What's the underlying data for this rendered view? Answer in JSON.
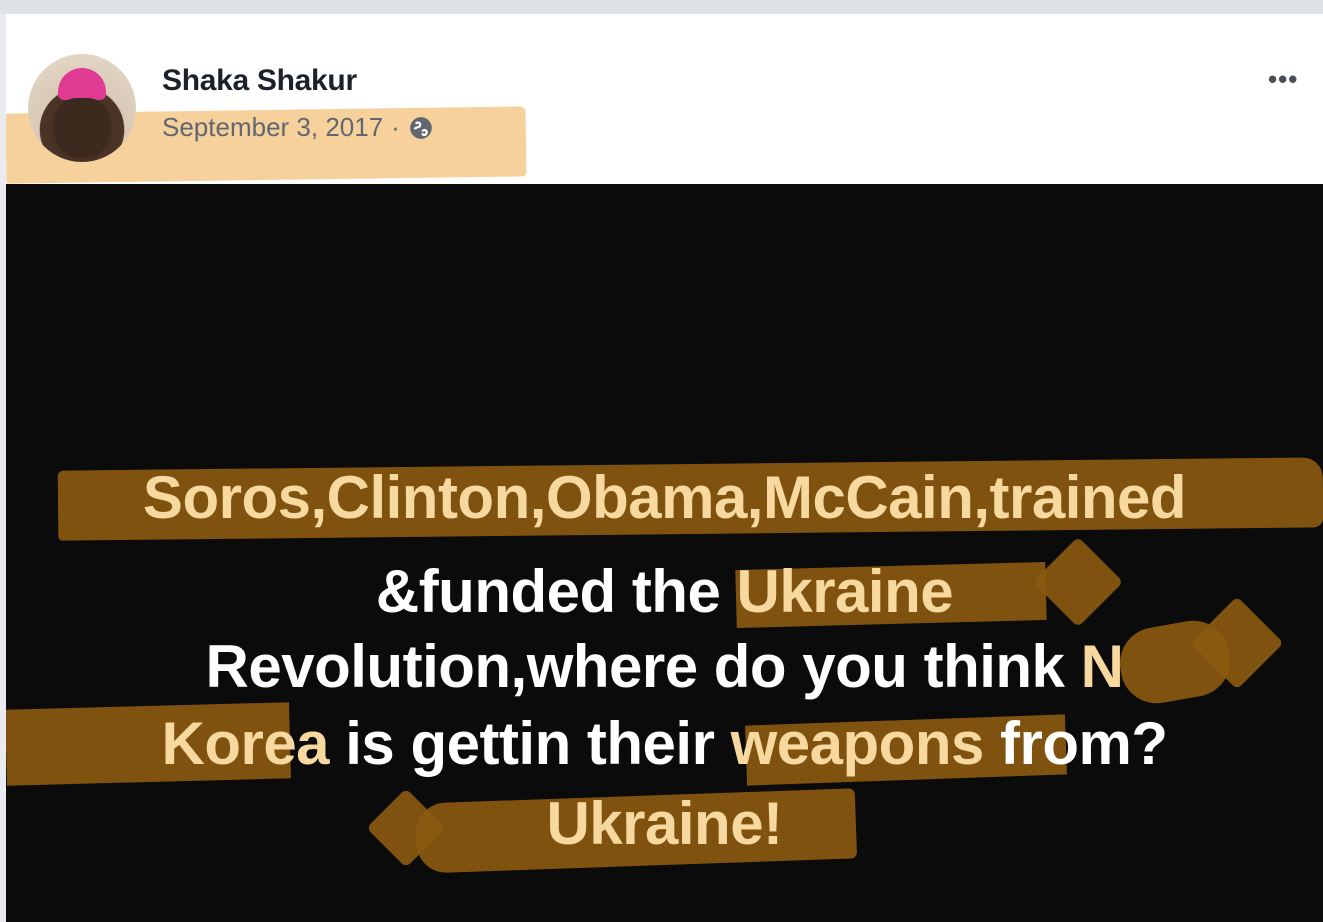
{
  "post": {
    "author": "Shaka Shakur",
    "date": "September 3, 2017",
    "separator": "·",
    "privacy_icon": "globe-icon",
    "more_label": "•••"
  },
  "image_text": {
    "line1": "Soros,Clinton,Obama,McCain,trained",
    "line2_a": "&funded the ",
    "line2_b": "Ukraine",
    "line3_a": "Revolution,where do you think ",
    "line3_b": "N",
    "line4_a": "Korea",
    "line4_b": " is gettin their ",
    "line4_c": "weapons",
    "line4_d": " from?",
    "line5": "Ukraine!"
  },
  "colors": {
    "highlight_header": "#f5c98a",
    "highlight_image": "#8a5a10",
    "image_background": "#0b0b0b"
  }
}
